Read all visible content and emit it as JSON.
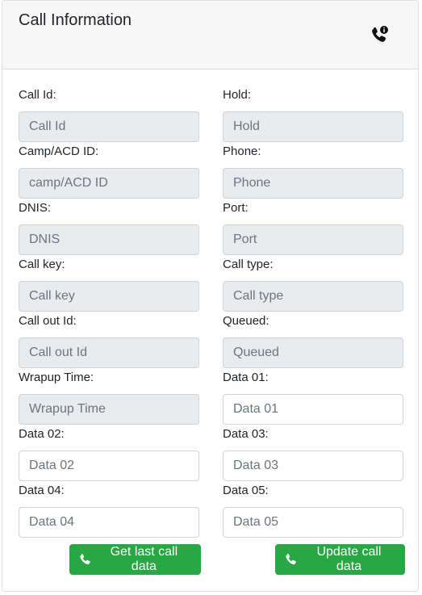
{
  "header": {
    "title": "Call Information",
    "icon": "phone-info-icon"
  },
  "rows": [
    [
      {
        "label": "Call Id:",
        "placeholder": "Call Id",
        "disabled": true
      },
      {
        "label": "Hold:",
        "placeholder": "Hold",
        "disabled": true
      }
    ],
    [
      {
        "label": "Camp/ACD ID:",
        "placeholder": "camp/ACD ID",
        "disabled": true
      },
      {
        "label": "Phone:",
        "placeholder": "Phone",
        "disabled": true
      }
    ],
    [
      {
        "label": "DNIS:",
        "placeholder": "DNIS",
        "disabled": true
      },
      {
        "label": "Port:",
        "placeholder": "Port",
        "disabled": true
      }
    ],
    [
      {
        "label": "Call key:",
        "placeholder": "Call key",
        "disabled": true
      },
      {
        "label": "Call type:",
        "placeholder": "Call type",
        "disabled": true
      }
    ],
    [
      {
        "label": "Call out Id:",
        "placeholder": "Call out Id",
        "disabled": true
      },
      {
        "label": "Queued:",
        "placeholder": "Queued",
        "disabled": true
      }
    ],
    [
      {
        "label": "Wrapup Time:",
        "placeholder": "Wrapup Time",
        "disabled": true
      },
      {
        "label": "Data 01:",
        "placeholder": "Data 01",
        "disabled": false
      }
    ],
    [
      {
        "label": "Data 02:",
        "placeholder": "Data 02",
        "disabled": false
      },
      {
        "label": "Data 03:",
        "placeholder": "Data 03",
        "disabled": false
      }
    ],
    [
      {
        "label": "Data 04:",
        "placeholder": "Data 04",
        "disabled": false
      },
      {
        "label": "Data 05:",
        "placeholder": "Data 05",
        "disabled": false
      }
    ]
  ],
  "actions": {
    "get_last": "Get last call data",
    "update": "Update call data",
    "button_color": "#28a745",
    "icon": "phone-icon"
  }
}
